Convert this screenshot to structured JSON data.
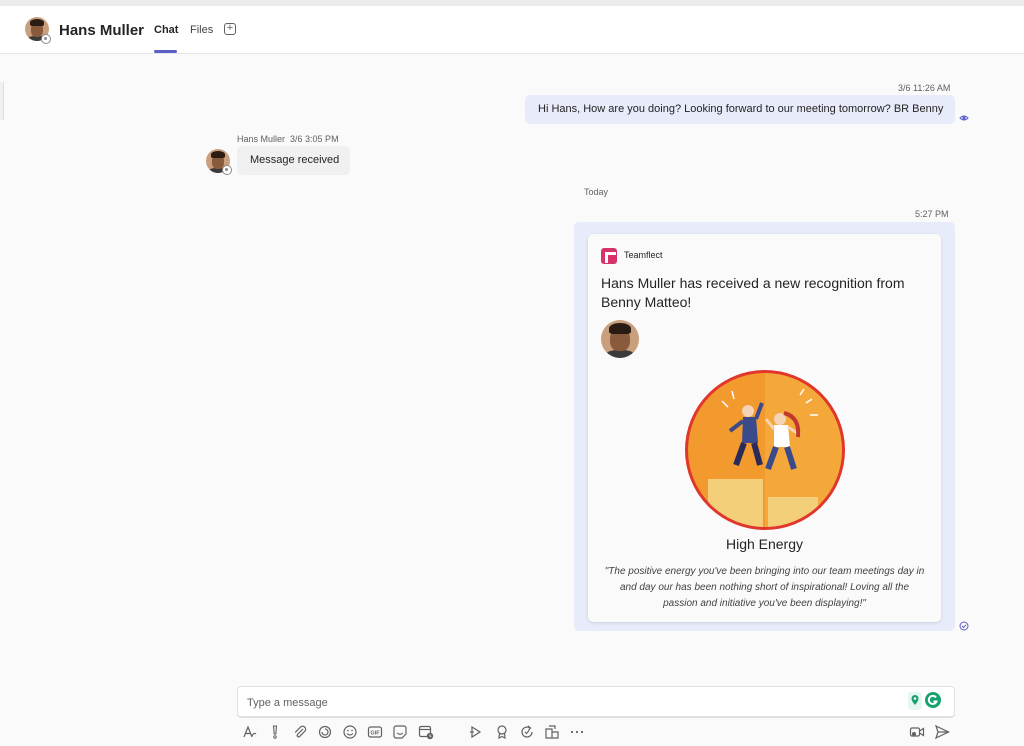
{
  "header": {
    "contact_name": "Hans Muller",
    "tabs": [
      {
        "label": "Chat",
        "active": true
      },
      {
        "label": "Files",
        "active": false
      }
    ],
    "add_tab_icon": "plus-icon"
  },
  "messages": {
    "sent_1": {
      "timestamp": "3/6 11:26 AM",
      "text": "Hi Hans, How are you doing? Looking forward to our meeting tomorrow? BR Benny"
    },
    "received_1": {
      "sender": "Hans Muller",
      "timestamp": "3/6 3:05 PM",
      "text": "Message received"
    },
    "divider": "Today",
    "sent_2": {
      "timestamp": "5:27 PM",
      "card": {
        "app_name": "Teamflect",
        "title": "Hans Muller has received a new recognition from Benny Matteo!",
        "badge_title": "High Energy",
        "quote": "\"The positive energy you've been bringing into our team meetings day in and day our has been nothing short of inspirational! Loving all the passion and initiative you've been displaying!\""
      }
    }
  },
  "composer": {
    "placeholder": "Type a message"
  },
  "toolbar": {
    "icons": [
      "format-icon",
      "important-icon",
      "attach-icon",
      "loop-icon",
      "emoji-icon",
      "gif-icon",
      "sticker-icon",
      "schedule-meeting-icon",
      "stream-icon",
      "praise-icon",
      "updates-icon",
      "apps-icon",
      "more-icon"
    ],
    "right_icons": [
      "video-clip-icon",
      "send-icon"
    ]
  },
  "colors": {
    "accent": "#5b5fc7",
    "my_bubble": "#e8ebfa",
    "their_bubble": "#f0f0f0",
    "teamflect": "#d6336c",
    "badge_orange": "#f29a2e",
    "badge_ring": "#e0362b"
  }
}
